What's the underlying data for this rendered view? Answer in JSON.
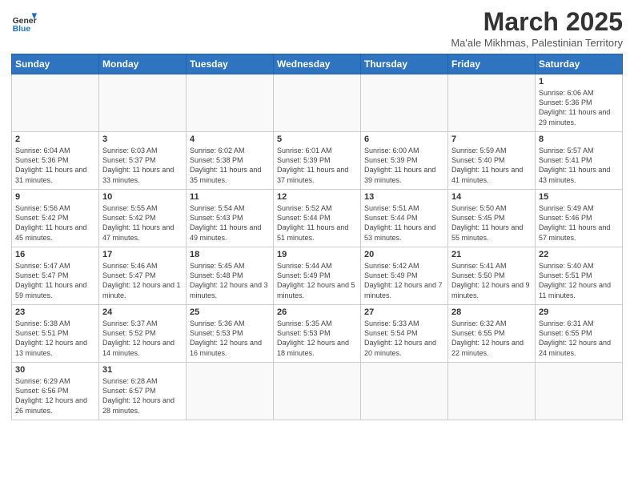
{
  "logo": {
    "text_general": "General",
    "text_blue": "Blue"
  },
  "header": {
    "month": "March 2025",
    "location": "Ma'ale Mikhmas, Palestinian Territory"
  },
  "weekdays": [
    "Sunday",
    "Monday",
    "Tuesday",
    "Wednesday",
    "Thursday",
    "Friday",
    "Saturday"
  ],
  "weeks": [
    [
      {
        "date": "",
        "info": ""
      },
      {
        "date": "",
        "info": ""
      },
      {
        "date": "",
        "info": ""
      },
      {
        "date": "",
        "info": ""
      },
      {
        "date": "",
        "info": ""
      },
      {
        "date": "",
        "info": ""
      },
      {
        "date": "1",
        "info": "Sunrise: 6:06 AM\nSunset: 5:36 PM\nDaylight: 11 hours and 29 minutes."
      }
    ],
    [
      {
        "date": "2",
        "info": "Sunrise: 6:04 AM\nSunset: 5:36 PM\nDaylight: 11 hours and 31 minutes."
      },
      {
        "date": "3",
        "info": "Sunrise: 6:03 AM\nSunset: 5:37 PM\nDaylight: 11 hours and 33 minutes."
      },
      {
        "date": "4",
        "info": "Sunrise: 6:02 AM\nSunset: 5:38 PM\nDaylight: 11 hours and 35 minutes."
      },
      {
        "date": "5",
        "info": "Sunrise: 6:01 AM\nSunset: 5:39 PM\nDaylight: 11 hours and 37 minutes."
      },
      {
        "date": "6",
        "info": "Sunrise: 6:00 AM\nSunset: 5:39 PM\nDaylight: 11 hours and 39 minutes."
      },
      {
        "date": "7",
        "info": "Sunrise: 5:59 AM\nSunset: 5:40 PM\nDaylight: 11 hours and 41 minutes."
      },
      {
        "date": "8",
        "info": "Sunrise: 5:57 AM\nSunset: 5:41 PM\nDaylight: 11 hours and 43 minutes."
      }
    ],
    [
      {
        "date": "9",
        "info": "Sunrise: 5:56 AM\nSunset: 5:42 PM\nDaylight: 11 hours and 45 minutes."
      },
      {
        "date": "10",
        "info": "Sunrise: 5:55 AM\nSunset: 5:42 PM\nDaylight: 11 hours and 47 minutes."
      },
      {
        "date": "11",
        "info": "Sunrise: 5:54 AM\nSunset: 5:43 PM\nDaylight: 11 hours and 49 minutes."
      },
      {
        "date": "12",
        "info": "Sunrise: 5:52 AM\nSunset: 5:44 PM\nDaylight: 11 hours and 51 minutes."
      },
      {
        "date": "13",
        "info": "Sunrise: 5:51 AM\nSunset: 5:44 PM\nDaylight: 11 hours and 53 minutes."
      },
      {
        "date": "14",
        "info": "Sunrise: 5:50 AM\nSunset: 5:45 PM\nDaylight: 11 hours and 55 minutes."
      },
      {
        "date": "15",
        "info": "Sunrise: 5:49 AM\nSunset: 5:46 PM\nDaylight: 11 hours and 57 minutes."
      }
    ],
    [
      {
        "date": "16",
        "info": "Sunrise: 5:47 AM\nSunset: 5:47 PM\nDaylight: 11 hours and 59 minutes."
      },
      {
        "date": "17",
        "info": "Sunrise: 5:46 AM\nSunset: 5:47 PM\nDaylight: 12 hours and 1 minute."
      },
      {
        "date": "18",
        "info": "Sunrise: 5:45 AM\nSunset: 5:48 PM\nDaylight: 12 hours and 3 minutes."
      },
      {
        "date": "19",
        "info": "Sunrise: 5:44 AM\nSunset: 5:49 PM\nDaylight: 12 hours and 5 minutes."
      },
      {
        "date": "20",
        "info": "Sunrise: 5:42 AM\nSunset: 5:49 PM\nDaylight: 12 hours and 7 minutes."
      },
      {
        "date": "21",
        "info": "Sunrise: 5:41 AM\nSunset: 5:50 PM\nDaylight: 12 hours and 9 minutes."
      },
      {
        "date": "22",
        "info": "Sunrise: 5:40 AM\nSunset: 5:51 PM\nDaylight: 12 hours and 11 minutes."
      }
    ],
    [
      {
        "date": "23",
        "info": "Sunrise: 5:38 AM\nSunset: 5:51 PM\nDaylight: 12 hours and 13 minutes."
      },
      {
        "date": "24",
        "info": "Sunrise: 5:37 AM\nSunset: 5:52 PM\nDaylight: 12 hours and 14 minutes."
      },
      {
        "date": "25",
        "info": "Sunrise: 5:36 AM\nSunset: 5:53 PM\nDaylight: 12 hours and 16 minutes."
      },
      {
        "date": "26",
        "info": "Sunrise: 5:35 AM\nSunset: 5:53 PM\nDaylight: 12 hours and 18 minutes."
      },
      {
        "date": "27",
        "info": "Sunrise: 5:33 AM\nSunset: 5:54 PM\nDaylight: 12 hours and 20 minutes."
      },
      {
        "date": "28",
        "info": "Sunrise: 6:32 AM\nSunset: 6:55 PM\nDaylight: 12 hours and 22 minutes."
      },
      {
        "date": "29",
        "info": "Sunrise: 6:31 AM\nSunset: 6:55 PM\nDaylight: 12 hours and 24 minutes."
      }
    ],
    [
      {
        "date": "30",
        "info": "Sunrise: 6:29 AM\nSunset: 6:56 PM\nDaylight: 12 hours and 26 minutes."
      },
      {
        "date": "31",
        "info": "Sunrise: 6:28 AM\nSunset: 6:57 PM\nDaylight: 12 hours and 28 minutes."
      },
      {
        "date": "",
        "info": ""
      },
      {
        "date": "",
        "info": ""
      },
      {
        "date": "",
        "info": ""
      },
      {
        "date": "",
        "info": ""
      },
      {
        "date": "",
        "info": ""
      }
    ]
  ]
}
